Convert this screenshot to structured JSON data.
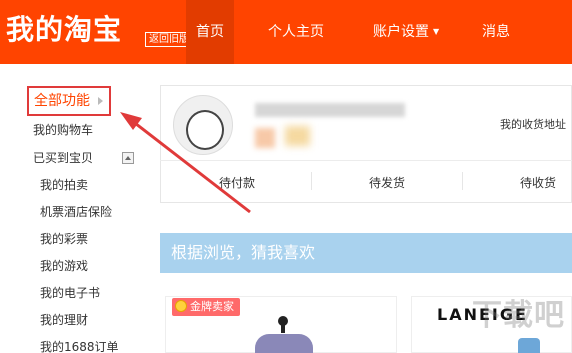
{
  "header": {
    "logo": "我的淘宝",
    "back_old": "返回旧版",
    "nav": {
      "home": "首页",
      "profile": "个人主页",
      "settings": "账户设置",
      "messages": "消息"
    }
  },
  "sidebar": {
    "all_functions": "全部功能",
    "items": [
      "我的购物车",
      "已买到宝贝",
      "我的拍卖",
      "机票酒店保险",
      "我的彩票",
      "我的游戏",
      "我的电子书",
      "我的理财",
      "我的1688订单"
    ]
  },
  "user_card": {
    "address_link": "我的收货地址",
    "orders": [
      "待付款",
      "待发货",
      "待收货"
    ]
  },
  "recommend": {
    "title": "根据浏览，猜我喜欢",
    "gold_seller": "金牌卖家",
    "brand": "LANEIGE"
  },
  "watermark": "下载吧",
  "colors": {
    "header_bg": "#ff4400",
    "annotation_red": "#e03a3a",
    "guess_bar": "#a9d2ee"
  }
}
